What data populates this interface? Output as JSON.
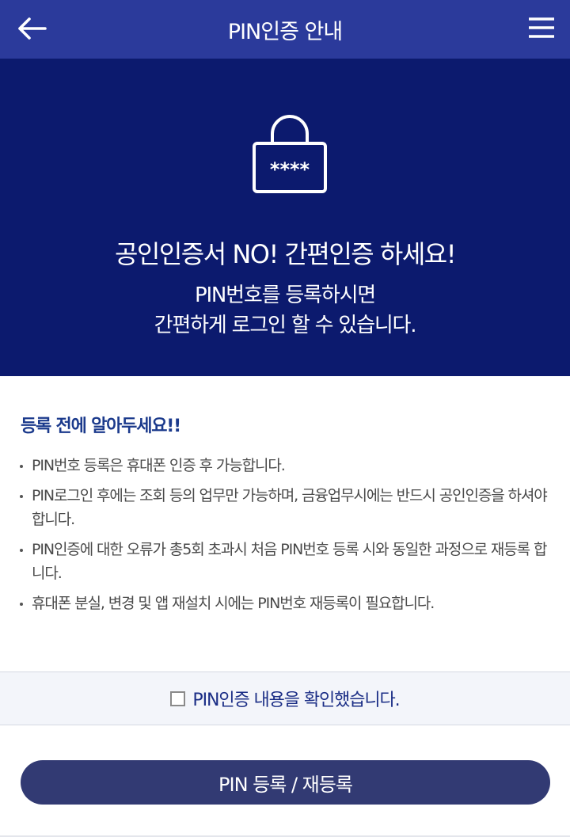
{
  "header": {
    "title": "PIN인증 안내",
    "back_icon": "arrow-left-icon",
    "menu_icon": "hamburger-menu-icon",
    "background": "#2b3a9b"
  },
  "hero": {
    "lock_icon": "lock-icon",
    "lock_text": "****",
    "headline": "공인인증서 NO! 간편인증 하세요!",
    "subline1": "PIN번호를 등록하시면",
    "subline2": "간편하게 로그인 할 수 있습니다.",
    "background": "#0c1a6e"
  },
  "notice": {
    "title": "등록 전에 알아두세요!!",
    "title_color": "#1b3a8c",
    "items": [
      "PIN번호 등록은 휴대폰 인증 후 가능합니다.",
      "PIN로그인 후에는 조회 등의 업무만 가능하며, 금융업무시에는 반드시 공인인증을 하셔야 합니다.",
      "PIN인증에 대한 오류가 총5회 초과시 처음 PIN번호 등록 시와 동일한 과정으로 재등록 합니다.",
      "휴대폰 분실, 변경 및 앱 재설치 시에는 PIN번호 재등록이 필요합니다."
    ]
  },
  "confirm": {
    "label": "PIN인증 내용을 확인했습니다.",
    "checked": false
  },
  "actions": {
    "register_label": "PIN 등록 / 재등록",
    "button_color": "#323a73"
  }
}
